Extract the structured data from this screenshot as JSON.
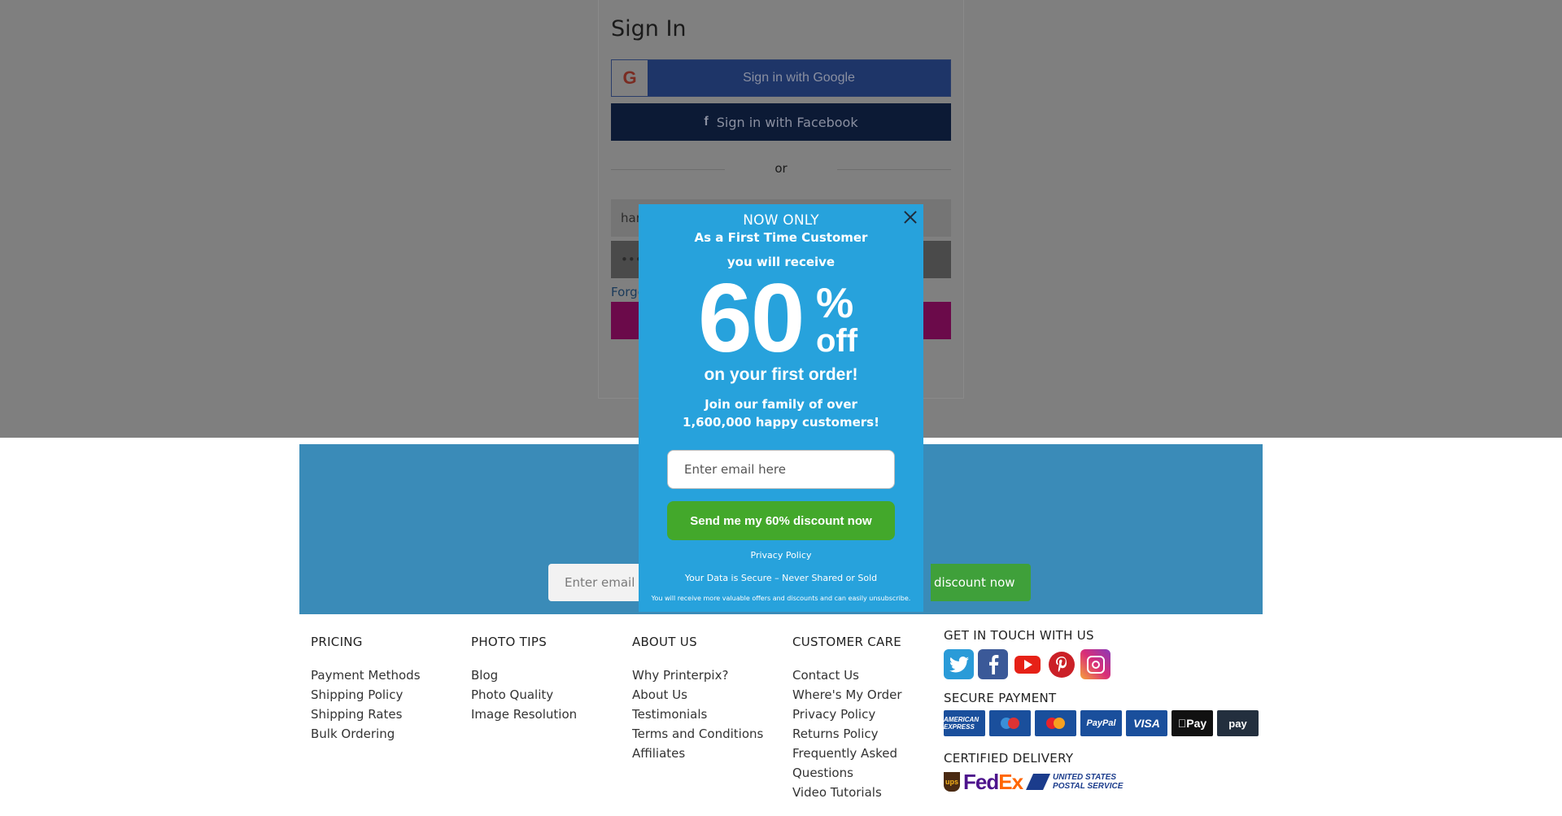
{
  "signin": {
    "title": "Sign In",
    "google_label": "Sign in with Google",
    "google_glyph": "G",
    "facebook_label": "Sign in with Facebook",
    "facebook_glyph": "f",
    "or_text": "or",
    "email_value": "har",
    "password_value": "••••",
    "forgot_link": "Forgo"
  },
  "newsletter": {
    "placeholder": "Enter email l",
    "button_label": "discount now"
  },
  "popup": {
    "headline": "NOW ONLY",
    "first_time": "As a First Time Customer",
    "receive": "you will receive",
    "big_number": "60",
    "percent": "%",
    "off": "off",
    "first_order": "on your first order!",
    "join_line1": "Join our family of over",
    "join_line2": "1,600,000 happy customers!",
    "email_placeholder": "Enter email here",
    "send_button": "Send me my 60% discount now",
    "privacy_link": "Privacy Policy",
    "secure_text": "Your Data is Secure – Never Shared or Sold",
    "fine_print": "You will receive more valuable offers and discounts and can easily unsubscribe."
  },
  "footer": {
    "columns": [
      {
        "title": "PRICING",
        "links": [
          "Payment Methods",
          "Shipping Policy",
          "Shipping Rates",
          "Bulk Ordering"
        ]
      },
      {
        "title": "PHOTO TIPS",
        "links": [
          "Blog",
          "Photo Quality",
          "Image Resolution"
        ]
      },
      {
        "title": "ABOUT US",
        "links": [
          "Why Printerpix?",
          "About Us",
          "Testimonials",
          "Terms and Conditions",
          "Affiliates"
        ]
      },
      {
        "title": "CUSTOMER CARE",
        "links": [
          "Contact Us",
          "Where's My Order",
          "Privacy Policy",
          "Returns Policy",
          "Frequently Asked",
          "Questions",
          "Video Tutorials"
        ]
      }
    ],
    "touch_title": "GET IN TOUCH WITH US",
    "social_icons": [
      "twitter-icon",
      "facebook-icon",
      "youtube-icon",
      "pinterest-icon",
      "instagram-icon"
    ],
    "payment_title": "SECURE PAYMENT",
    "payment_cards": [
      {
        "name": "amex",
        "label": "AMERICAN EXPRESS"
      },
      {
        "name": "maestro",
        "label": "Maestro"
      },
      {
        "name": "mastercard",
        "label": "MasterCard"
      },
      {
        "name": "paypal",
        "label": "PayPal"
      },
      {
        "name": "visa",
        "label": "VISA"
      },
      {
        "name": "apple-pay",
        "label": "Pay"
      },
      {
        "name": "amazon-pay",
        "label": "pay"
      }
    ],
    "delivery_title": "CERTIFIED DELIVERY",
    "ups_label": "ups",
    "fedex_fe": "Fed",
    "fedex_ex": "Ex",
    "usps_line1": "UNITED STATES",
    "usps_line2": "POSTAL SERVICE"
  },
  "colors": {
    "popup_bg": "#27a2dc",
    "send_button": "#43a82b",
    "newsletter_bg": "#3a8bb8",
    "overlay": "#7f7f7f"
  }
}
